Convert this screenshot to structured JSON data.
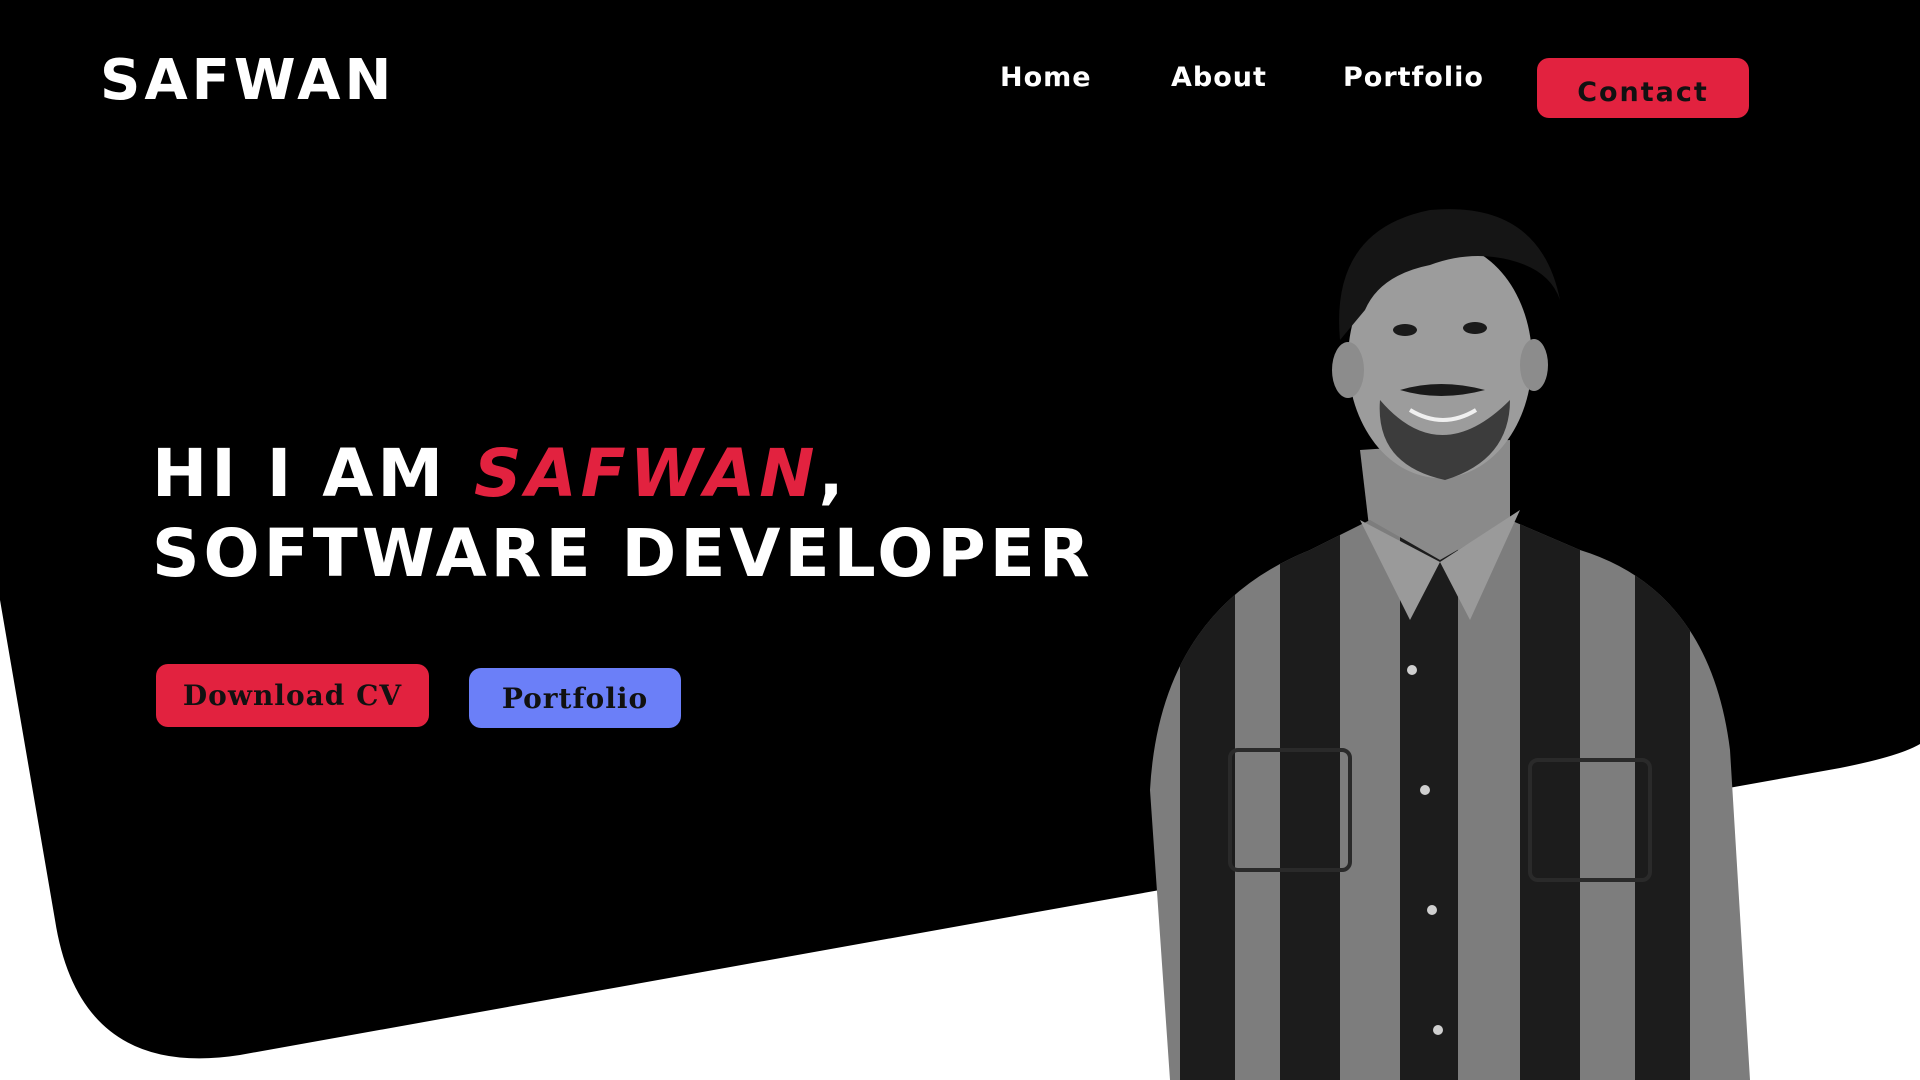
{
  "brand": {
    "logo": "SAFWAN"
  },
  "nav": {
    "items": [
      {
        "label": "Home"
      },
      {
        "label": "About"
      },
      {
        "label": "Portfolio"
      }
    ],
    "contact_label": "Contact"
  },
  "hero": {
    "greeting_prefix": "HI I AM ",
    "name": "SAFWAN",
    "comma": ",",
    "role": "SOFTWARE DEVELOPER",
    "download_cv_label": "Download CV",
    "portfolio_label": "Portfolio"
  },
  "colors": {
    "background": "#000000",
    "accent": "#e2223f",
    "secondary_button": "#6b7ff8",
    "text": "#ffffff"
  },
  "image": {
    "alt": "black-and-white portrait of a smiling young man in a striped shirt"
  }
}
